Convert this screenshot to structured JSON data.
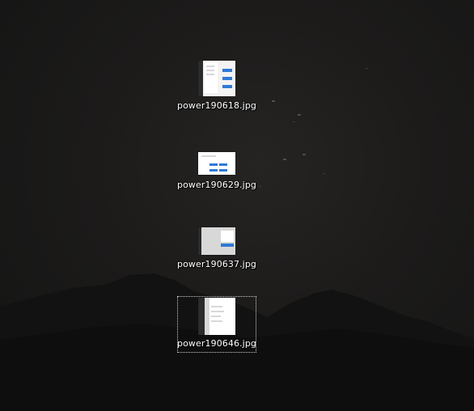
{
  "desktop": {
    "icons": [
      {
        "label": "power190618.jpg",
        "icon": "image-file-icon",
        "selected": false
      },
      {
        "label": "power190629.jpg",
        "icon": "image-file-icon",
        "selected": false
      },
      {
        "label": "power190637.jpg",
        "icon": "image-file-icon",
        "selected": false
      },
      {
        "label": "power190646.jpg",
        "icon": "image-file-icon",
        "selected": true
      }
    ]
  }
}
